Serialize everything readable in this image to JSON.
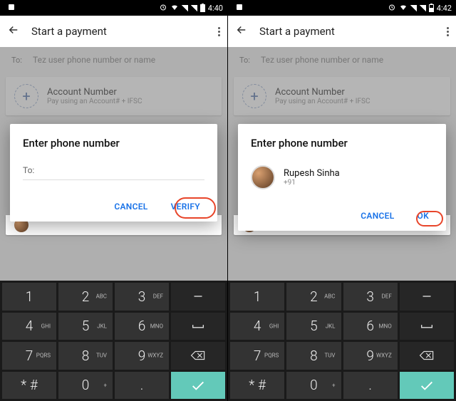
{
  "screens": [
    {
      "status": {
        "time": "4:40"
      },
      "appbar": {
        "title": "Start a payment"
      },
      "search": {
        "to_label": "To:",
        "placeholder": "Tez user phone number or name"
      },
      "account_card": {
        "title": "Account Number",
        "subtitle": "Pay using an Account# + IFSC"
      },
      "dialog": {
        "title": "Enter phone number",
        "to_label": "To:",
        "cancel": "CANCEL",
        "confirm": "VERIFY"
      }
    },
    {
      "status": {
        "time": "4:42"
      },
      "appbar": {
        "title": "Start a payment"
      },
      "search": {
        "to_label": "To:",
        "placeholder": "Tez user phone number or name"
      },
      "account_card": {
        "title": "Account Number",
        "subtitle": "Pay using an Account# + IFSC"
      },
      "dialog": {
        "title": "Enter phone number",
        "contact": {
          "name": "Rupesh Sinha",
          "phone": "+91"
        },
        "cancel": "CANCEL",
        "confirm": "OK"
      }
    }
  ],
  "keypad": {
    "rows": [
      [
        {
          "n": "1",
          "l": ""
        },
        {
          "n": "2",
          "l": "ABC"
        },
        {
          "n": "3",
          "l": "DEF"
        },
        {
          "type": "dash"
        }
      ],
      [
        {
          "n": "4",
          "l": "GHI"
        },
        {
          "n": "5",
          "l": "JKL"
        },
        {
          "n": "6",
          "l": "MNO"
        },
        {
          "type": "space"
        }
      ],
      [
        {
          "n": "7",
          "l": "PQRS"
        },
        {
          "n": "8",
          "l": "TUV"
        },
        {
          "n": "9",
          "l": "WXYZ"
        },
        {
          "type": "backspace"
        }
      ],
      [
        {
          "n": "* #",
          "l": ""
        },
        {
          "n": "0",
          "l": "+"
        },
        {
          "n": ".",
          "l": ""
        },
        {
          "type": "enter"
        }
      ]
    ]
  }
}
